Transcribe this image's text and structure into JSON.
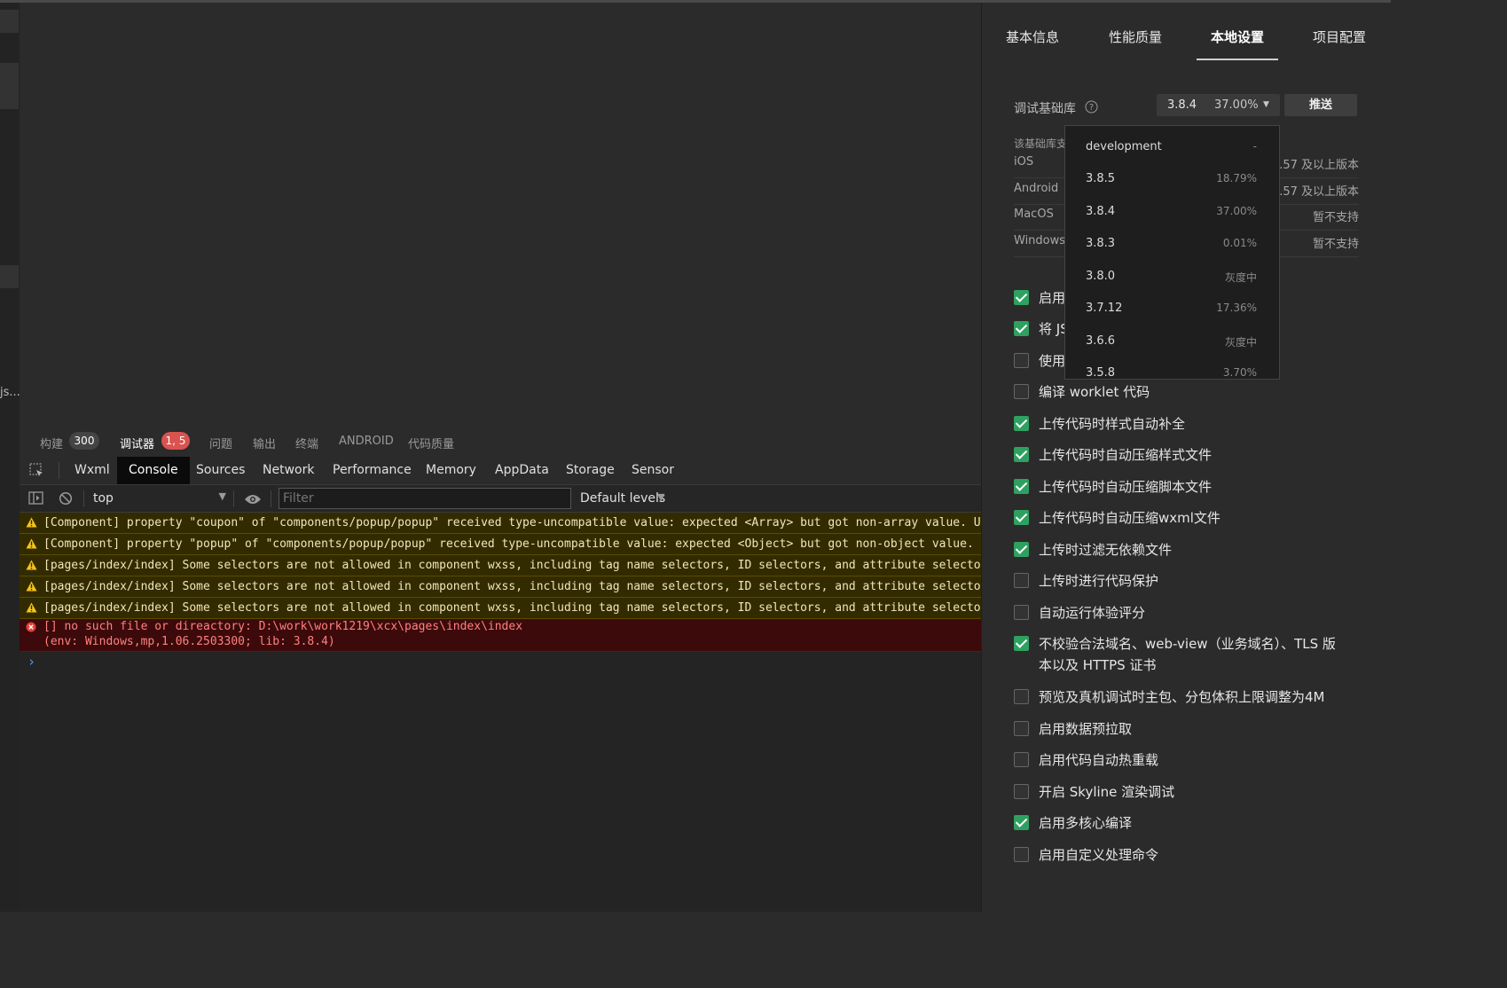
{
  "left_strip": {
    "file_fragment": "js..."
  },
  "panel_tabs": [
    {
      "label": "构建",
      "badge": "300"
    },
    {
      "label": "调试器",
      "badge": "1, 5"
    },
    {
      "label": "问题"
    },
    {
      "label": "输出"
    },
    {
      "label": "终端"
    },
    {
      "label": "ANDROID"
    },
    {
      "label": "代码质量"
    }
  ],
  "devtools_tabs": [
    "Wxml",
    "Console",
    "Sources",
    "Network",
    "Performance",
    "Memory",
    "AppData",
    "Storage",
    "Sensor"
  ],
  "active_devtools_tab": "Console",
  "toolbar": {
    "context": "top",
    "filter_placeholder": "Filter",
    "levels": "Default levels"
  },
  "console_messages": [
    {
      "level": "warning",
      "text": "[Component] property \"coupon\" of \"components/popup/popup\" received type-uncompatible value: expected <Array> but got non-array value. Used"
    },
    {
      "level": "warning",
      "text": "[Component] property \"popup\" of \"components/popup/popup\" received type-uncompatible value: expected <Object> but got non-object value. Used"
    },
    {
      "level": "warning",
      "text": "[pages/index/index] Some selectors are not allowed in component wxss, including tag name selectors, ID selectors, and attribute selectors.("
    },
    {
      "level": "warning",
      "text": "[pages/index/index] Some selectors are not allowed in component wxss, including tag name selectors, ID selectors, and attribute selectors.("
    },
    {
      "level": "warning",
      "text": "[pages/index/index] Some selectors are not allowed in component wxss, including tag name selectors, ID selectors, and attribute selectors.("
    }
  ],
  "console_error": {
    "line1": "[] no such file or direactory: D:\\work\\work1219\\xcx\\pages\\index\\index",
    "line2": "(env: Windows,mp,1.06.2503300; lib: 3.8.4)"
  },
  "console_prompt": "›",
  "right_panel": {
    "tabs": [
      "基本信息",
      "性能质量",
      "本地设置",
      "项目配置"
    ],
    "active_tab": "本地设置",
    "debug_lib": {
      "label": "调试基础库",
      "selected_version": "3.8.4",
      "selected_percent": "37.00%",
      "push_button": "推送",
      "support_label": "该基础库支",
      "os_rows": [
        {
          "os": "iOS",
          "value": "0.57 及以上版本"
        },
        {
          "os": "Android",
          "value": "0.57 及以上版本"
        },
        {
          "os": "MacOS",
          "value": "暂不支持"
        },
        {
          "os": "Windows",
          "value": "暂不支持"
        }
      ]
    },
    "dropdown": [
      {
        "version": "development",
        "percent": "-"
      },
      {
        "version": "3.8.5",
        "percent": "18.79%"
      },
      {
        "version": "3.8.4",
        "percent": "37.00%"
      },
      {
        "version": "3.8.3",
        "percent": "0.01%"
      },
      {
        "version": "3.8.0",
        "percent": "灰度中"
      },
      {
        "version": "3.7.12",
        "percent": "17.36%"
      },
      {
        "version": "3.6.6",
        "percent": "灰度中"
      },
      {
        "version": "3.5.8",
        "percent": "3.70%"
      }
    ],
    "settings": [
      {
        "label": "启用",
        "checked": true
      },
      {
        "label": "将 JS",
        "checked": true
      },
      {
        "label": "使用",
        "checked": false
      },
      {
        "label": "编译 worklet 代码",
        "checked": false
      },
      {
        "label": "上传代码时样式自动补全",
        "checked": true
      },
      {
        "label": "上传代码时自动压缩样式文件",
        "checked": true
      },
      {
        "label": "上传代码时自动压缩脚本文件",
        "checked": true
      },
      {
        "label": "上传代码时自动压缩wxml文件",
        "checked": true
      },
      {
        "label": "上传时过滤无依赖文件",
        "checked": true
      },
      {
        "label": "上传时进行代码保护",
        "checked": false
      },
      {
        "label": "自动运行体验评分",
        "checked": false
      },
      {
        "label": "不校验合法域名、web-view（业务域名）、TLS 版",
        "label2": "本以及 HTTPS 证书",
        "checked": true
      },
      {
        "label": "预览及真机调试时主包、分包体积上限调整为4M",
        "checked": false
      },
      {
        "label": "启用数据预拉取",
        "checked": false
      },
      {
        "label": "启用代码自动热重载",
        "checked": false
      },
      {
        "label": "开启 Skyline 渲染调试",
        "checked": false
      },
      {
        "label": "启用多核心编译",
        "checked": true
      },
      {
        "label": "启用自定义处理命令",
        "checked": false
      }
    ]
  },
  "colors": {
    "checkbox_on": "#2ea160",
    "badge_error": "#d9534f",
    "badge_build": "#444444"
  }
}
